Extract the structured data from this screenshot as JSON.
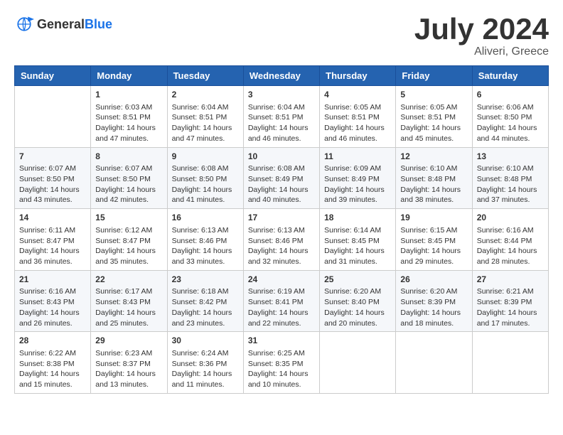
{
  "header": {
    "logo_general": "General",
    "logo_blue": "Blue",
    "title": "July 2024",
    "location": "Aliveri, Greece"
  },
  "weekdays": [
    "Sunday",
    "Monday",
    "Tuesday",
    "Wednesday",
    "Thursday",
    "Friday",
    "Saturday"
  ],
  "weeks": [
    [
      {
        "day": "",
        "info": ""
      },
      {
        "day": "1",
        "info": "Sunrise: 6:03 AM\nSunset: 8:51 PM\nDaylight: 14 hours\nand 47 minutes."
      },
      {
        "day": "2",
        "info": "Sunrise: 6:04 AM\nSunset: 8:51 PM\nDaylight: 14 hours\nand 47 minutes."
      },
      {
        "day": "3",
        "info": "Sunrise: 6:04 AM\nSunset: 8:51 PM\nDaylight: 14 hours\nand 46 minutes."
      },
      {
        "day": "4",
        "info": "Sunrise: 6:05 AM\nSunset: 8:51 PM\nDaylight: 14 hours\nand 46 minutes."
      },
      {
        "day": "5",
        "info": "Sunrise: 6:05 AM\nSunset: 8:51 PM\nDaylight: 14 hours\nand 45 minutes."
      },
      {
        "day": "6",
        "info": "Sunrise: 6:06 AM\nSunset: 8:50 PM\nDaylight: 14 hours\nand 44 minutes."
      }
    ],
    [
      {
        "day": "7",
        "info": "Sunrise: 6:07 AM\nSunset: 8:50 PM\nDaylight: 14 hours\nand 43 minutes."
      },
      {
        "day": "8",
        "info": "Sunrise: 6:07 AM\nSunset: 8:50 PM\nDaylight: 14 hours\nand 42 minutes."
      },
      {
        "day": "9",
        "info": "Sunrise: 6:08 AM\nSunset: 8:50 PM\nDaylight: 14 hours\nand 41 minutes."
      },
      {
        "day": "10",
        "info": "Sunrise: 6:08 AM\nSunset: 8:49 PM\nDaylight: 14 hours\nand 40 minutes."
      },
      {
        "day": "11",
        "info": "Sunrise: 6:09 AM\nSunset: 8:49 PM\nDaylight: 14 hours\nand 39 minutes."
      },
      {
        "day": "12",
        "info": "Sunrise: 6:10 AM\nSunset: 8:48 PM\nDaylight: 14 hours\nand 38 minutes."
      },
      {
        "day": "13",
        "info": "Sunrise: 6:10 AM\nSunset: 8:48 PM\nDaylight: 14 hours\nand 37 minutes."
      }
    ],
    [
      {
        "day": "14",
        "info": "Sunrise: 6:11 AM\nSunset: 8:47 PM\nDaylight: 14 hours\nand 36 minutes."
      },
      {
        "day": "15",
        "info": "Sunrise: 6:12 AM\nSunset: 8:47 PM\nDaylight: 14 hours\nand 35 minutes."
      },
      {
        "day": "16",
        "info": "Sunrise: 6:13 AM\nSunset: 8:46 PM\nDaylight: 14 hours\nand 33 minutes."
      },
      {
        "day": "17",
        "info": "Sunrise: 6:13 AM\nSunset: 8:46 PM\nDaylight: 14 hours\nand 32 minutes."
      },
      {
        "day": "18",
        "info": "Sunrise: 6:14 AM\nSunset: 8:45 PM\nDaylight: 14 hours\nand 31 minutes."
      },
      {
        "day": "19",
        "info": "Sunrise: 6:15 AM\nSunset: 8:45 PM\nDaylight: 14 hours\nand 29 minutes."
      },
      {
        "day": "20",
        "info": "Sunrise: 6:16 AM\nSunset: 8:44 PM\nDaylight: 14 hours\nand 28 minutes."
      }
    ],
    [
      {
        "day": "21",
        "info": "Sunrise: 6:16 AM\nSunset: 8:43 PM\nDaylight: 14 hours\nand 26 minutes."
      },
      {
        "day": "22",
        "info": "Sunrise: 6:17 AM\nSunset: 8:43 PM\nDaylight: 14 hours\nand 25 minutes."
      },
      {
        "day": "23",
        "info": "Sunrise: 6:18 AM\nSunset: 8:42 PM\nDaylight: 14 hours\nand 23 minutes."
      },
      {
        "day": "24",
        "info": "Sunrise: 6:19 AM\nSunset: 8:41 PM\nDaylight: 14 hours\nand 22 minutes."
      },
      {
        "day": "25",
        "info": "Sunrise: 6:20 AM\nSunset: 8:40 PM\nDaylight: 14 hours\nand 20 minutes."
      },
      {
        "day": "26",
        "info": "Sunrise: 6:20 AM\nSunset: 8:39 PM\nDaylight: 14 hours\nand 18 minutes."
      },
      {
        "day": "27",
        "info": "Sunrise: 6:21 AM\nSunset: 8:39 PM\nDaylight: 14 hours\nand 17 minutes."
      }
    ],
    [
      {
        "day": "28",
        "info": "Sunrise: 6:22 AM\nSunset: 8:38 PM\nDaylight: 14 hours\nand 15 minutes."
      },
      {
        "day": "29",
        "info": "Sunrise: 6:23 AM\nSunset: 8:37 PM\nDaylight: 14 hours\nand 13 minutes."
      },
      {
        "day": "30",
        "info": "Sunrise: 6:24 AM\nSunset: 8:36 PM\nDaylight: 14 hours\nand 11 minutes."
      },
      {
        "day": "31",
        "info": "Sunrise: 6:25 AM\nSunset: 8:35 PM\nDaylight: 14 hours\nand 10 minutes."
      },
      {
        "day": "",
        "info": ""
      },
      {
        "day": "",
        "info": ""
      },
      {
        "day": "",
        "info": ""
      }
    ]
  ]
}
